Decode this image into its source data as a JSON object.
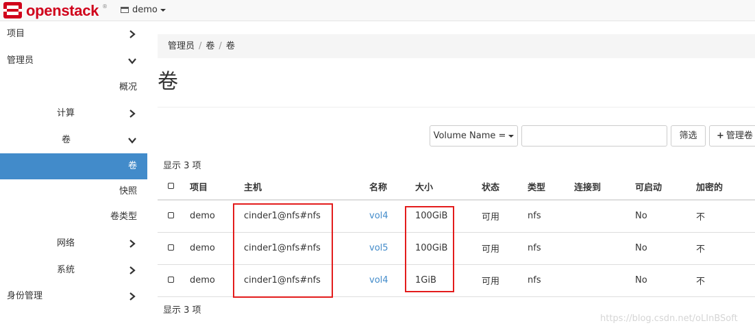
{
  "brand": {
    "name": "openstack",
    "tm": "®",
    "color": "#d0021b"
  },
  "project": {
    "label": "demo"
  },
  "sidebar": {
    "items": [
      {
        "label": "项目",
        "icon": "chevron-right-icon"
      },
      {
        "label": "管理员",
        "icon": "chevron-down-icon"
      },
      {
        "label": "概况"
      },
      {
        "label": "计算",
        "icon": "chevron-right-icon"
      },
      {
        "label": "卷",
        "icon": "chevron-down-icon"
      },
      {
        "label": "卷",
        "active": true
      },
      {
        "label": "快照"
      },
      {
        "label": "卷类型"
      },
      {
        "label": "网络",
        "icon": "chevron-right-icon"
      },
      {
        "label": "系统",
        "icon": "chevron-right-icon"
      },
      {
        "label": "身份管理",
        "icon": "chevron-right-icon"
      }
    ]
  },
  "breadcrumb": [
    "管理员",
    "卷",
    "卷"
  ],
  "page": {
    "title": "卷"
  },
  "filter": {
    "field": "Volume Name =",
    "value": "",
    "button": "筛选",
    "manage_button": "管理卷"
  },
  "summary": {
    "top": "显示 3 项",
    "bottom": "显示 3 项"
  },
  "table": {
    "columns": [
      "项目",
      "主机",
      "名称",
      "大小",
      "状态",
      "类型",
      "连接到",
      "可启动",
      "加密的"
    ],
    "rows": [
      {
        "project": "demo",
        "host": "cinder1@nfs#nfs",
        "name": "vol4",
        "size": "100GiB",
        "status": "可用",
        "type": "nfs",
        "attached": "",
        "bootable": "No",
        "encrypted": "不"
      },
      {
        "project": "demo",
        "host": "cinder1@nfs#nfs",
        "name": "vol5",
        "size": "100GiB",
        "status": "可用",
        "type": "nfs",
        "attached": "",
        "bootable": "No",
        "encrypted": "不"
      },
      {
        "project": "demo",
        "host": "cinder1@nfs#nfs",
        "name": "vol4",
        "size": "1GiB",
        "status": "可用",
        "type": "nfs",
        "attached": "",
        "bootable": "No",
        "encrypted": "不"
      }
    ]
  },
  "colors": {
    "active_nav": "#428bca",
    "link": "#428bca",
    "highlight": "#e31b1b"
  },
  "watermark": "https://blog.csdn.net/oLInBSoft"
}
